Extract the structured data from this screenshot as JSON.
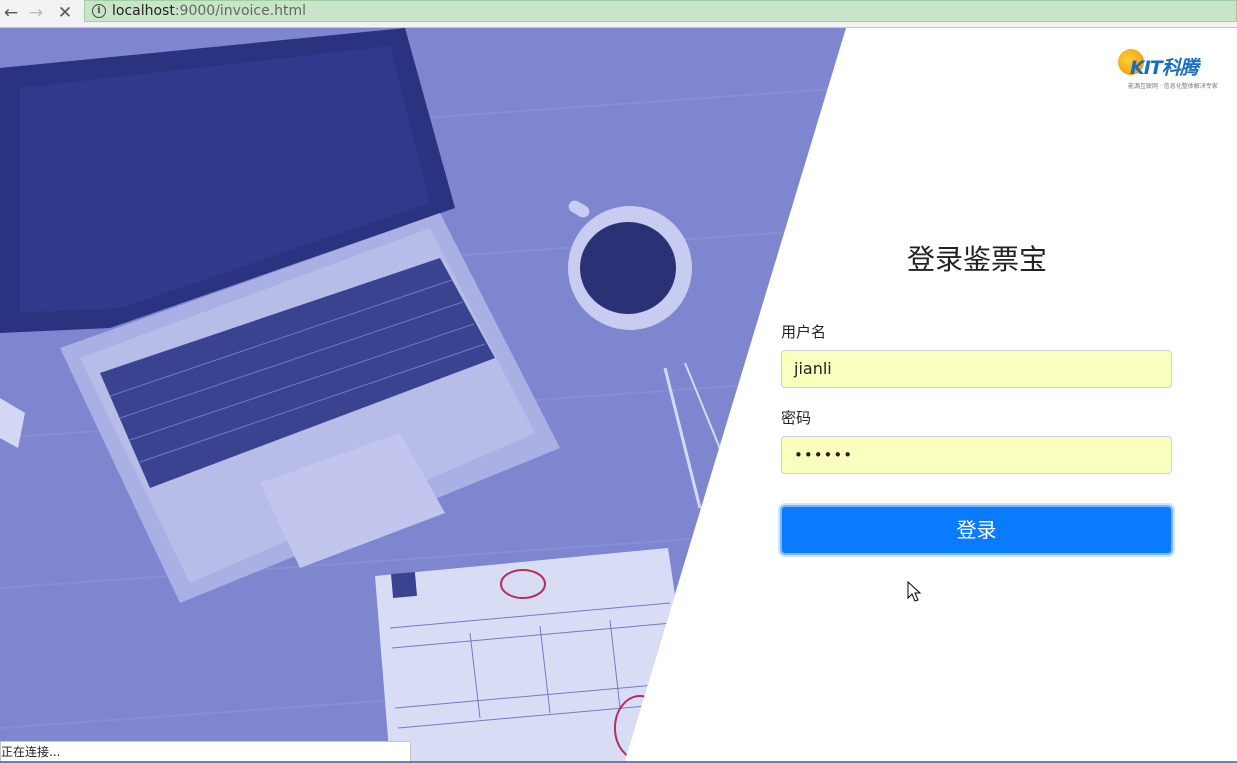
{
  "browser": {
    "url_host": "localhost",
    "url_path": ":9000/invoice.html",
    "status_text": "正在连接..."
  },
  "brand": {
    "logo_text": "KIT科腾",
    "tagline": "能源互联网 · 信息化整体解决专家"
  },
  "login": {
    "title": "登录鉴票宝",
    "username_label": "用户名",
    "username_value": "jianli",
    "password_label": "密码",
    "password_value": "••••••",
    "submit_label": "登录"
  },
  "colors": {
    "accent": "#0a7bff",
    "autofill": "#faffbd",
    "hero_tint": "#7d86cf"
  }
}
